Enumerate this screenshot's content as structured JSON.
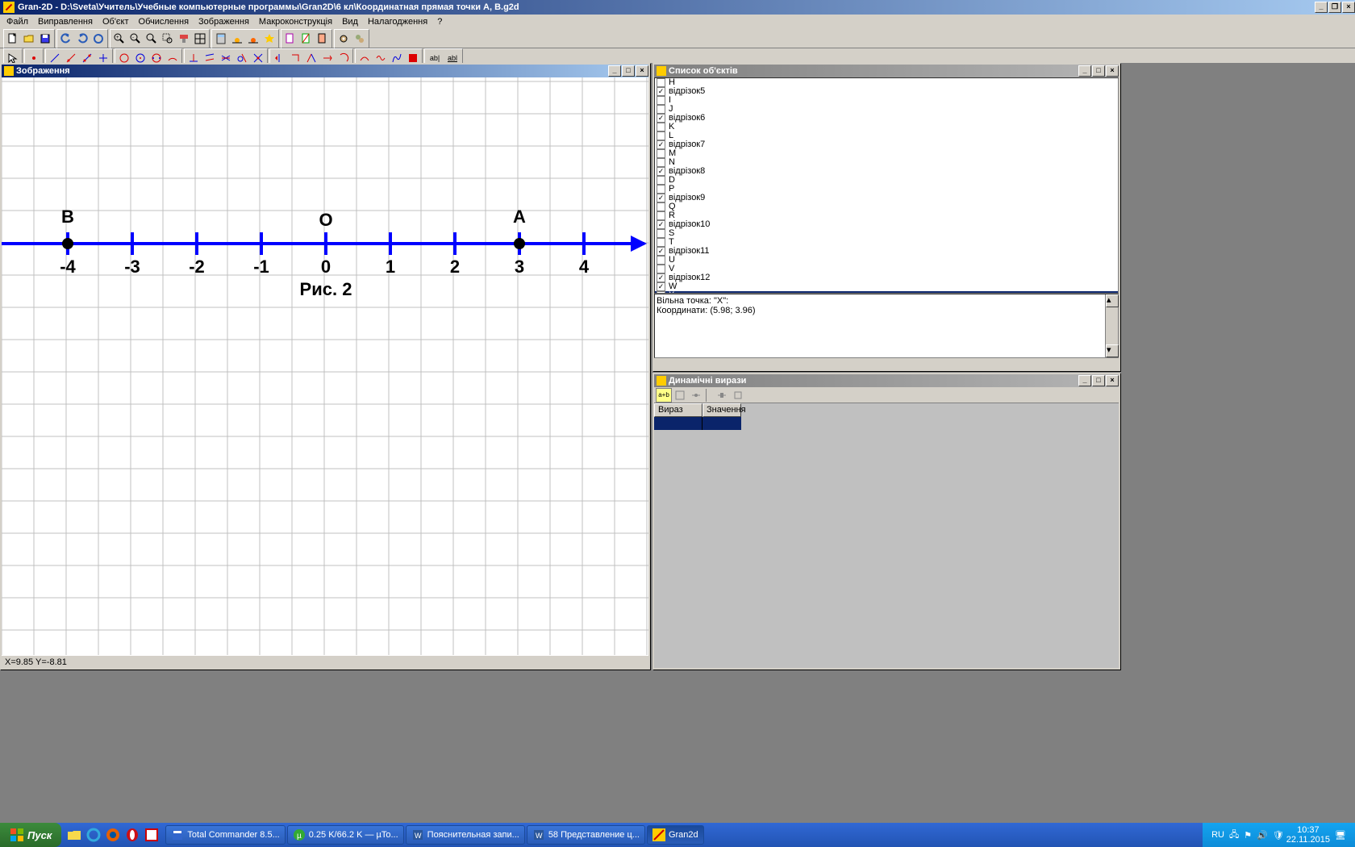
{
  "app_title": "Gran-2D - D:\\Sveta\\Учитель\\Учебные компьютерные программы\\Gran2D\\6 кл\\Координатная прямая точки А, В.g2d",
  "menu": [
    "Файл",
    "Виправлення",
    "Об'єкт",
    "Обчислення",
    "Зображення",
    "Макроконструкція",
    "Вид",
    "Налагодження",
    "?"
  ],
  "win_image": {
    "title": "Зображення",
    "status": "X=9.85 Y=-8.81"
  },
  "win_objects": {
    "title": "Список об'єктів"
  },
  "win_dyn": {
    "title": "Динамічні вирази"
  },
  "chart_data": {
    "type": "line",
    "ticks": [
      -4,
      -3,
      -2,
      -1,
      0,
      1,
      2,
      3,
      4
    ],
    "origin_label": "O",
    "points": [
      {
        "name": "B",
        "x": -4
      },
      {
        "name": "A",
        "x": 3
      }
    ],
    "caption": "Рис. 2"
  },
  "objects": [
    {
      "label": "H",
      "checked": false
    },
    {
      "label": "відрізок5",
      "checked": true
    },
    {
      "label": "I",
      "checked": false
    },
    {
      "label": "J",
      "checked": false
    },
    {
      "label": "відрізок6",
      "checked": true
    },
    {
      "label": "K",
      "checked": false
    },
    {
      "label": "L",
      "checked": false
    },
    {
      "label": "відрізок7",
      "checked": true
    },
    {
      "label": "M",
      "checked": false
    },
    {
      "label": "N",
      "checked": false
    },
    {
      "label": "відрізок8",
      "checked": true
    },
    {
      "label": "D",
      "checked": false
    },
    {
      "label": "P",
      "checked": false
    },
    {
      "label": "відрізок9",
      "checked": true
    },
    {
      "label": "Q",
      "checked": false
    },
    {
      "label": "R",
      "checked": false
    },
    {
      "label": "відрізок10",
      "checked": true
    },
    {
      "label": "S",
      "checked": false
    },
    {
      "label": "T",
      "checked": false
    },
    {
      "label": "відрізок11",
      "checked": true
    },
    {
      "label": "U",
      "checked": false
    },
    {
      "label": "V",
      "checked": false
    },
    {
      "label": "відрізок12",
      "checked": true
    },
    {
      "label": "W",
      "checked": true
    },
    {
      "label": "X",
      "checked": true,
      "selected": true
    }
  ],
  "detail_line1": "Вільна точка: \"X\":",
  "detail_line2": "Координати: (5.98; 3.96)",
  "dyn_headers": [
    "Вираз",
    "Значення"
  ],
  "taskbar": {
    "start": "Пуск",
    "tasks": [
      {
        "label": "Total Commander 8.5..."
      },
      {
        "label": "0.25 K/66.2 K — µTo..."
      },
      {
        "label": "Пояснительная запи..."
      },
      {
        "label": "58 Представление ц..."
      },
      {
        "label": "Gran2d",
        "active": true
      }
    ],
    "lang": "RU",
    "time": "10:37",
    "date": "22.11.2015"
  }
}
